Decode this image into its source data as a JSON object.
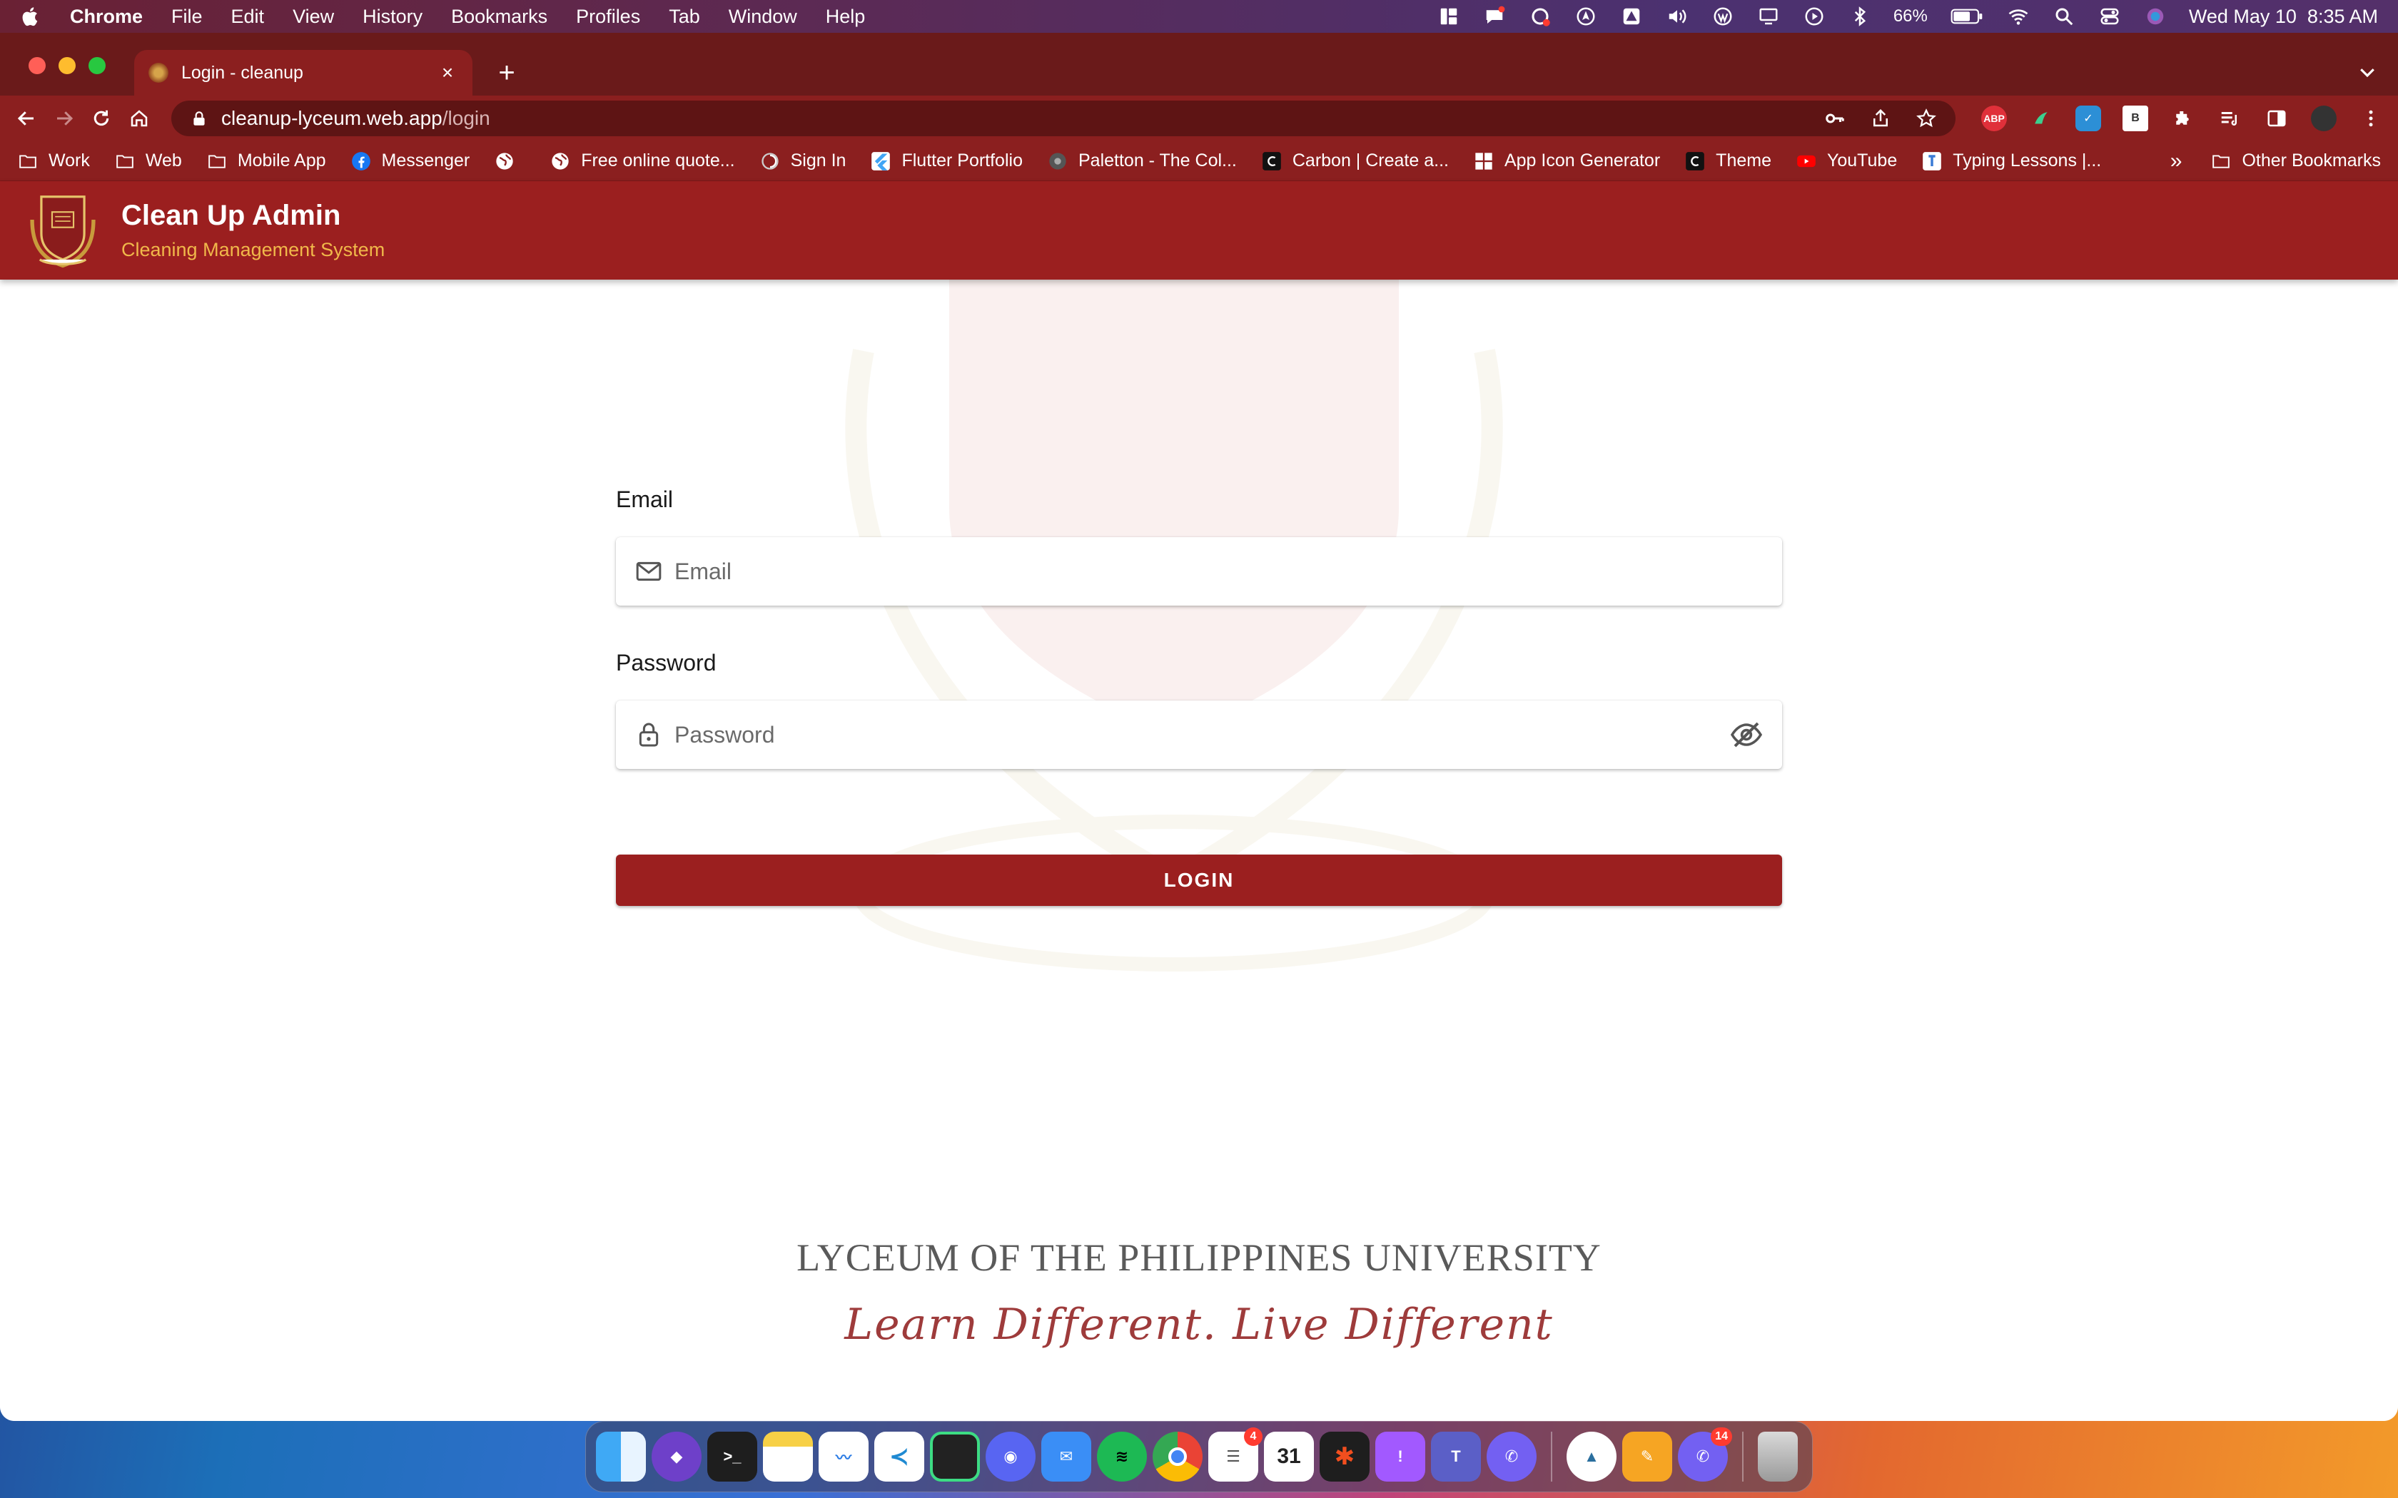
{
  "menubar": {
    "app_name": "Chrome",
    "items": [
      "File",
      "Edit",
      "View",
      "History",
      "Bookmarks",
      "Profiles",
      "Tab",
      "Window",
      "Help"
    ],
    "battery": "66%",
    "datetime": "Wed May 10  8:35 AM"
  },
  "browser": {
    "tab_title": "Login - cleanup",
    "url_host": "cleanup-lyceum.web.app",
    "url_path": "/login",
    "bookmarks": [
      {
        "label": "Work",
        "icon": "folder-icon"
      },
      {
        "label": "Web",
        "icon": "folder-icon"
      },
      {
        "label": "Mobile App",
        "icon": "folder-icon"
      },
      {
        "label": "Messenger",
        "icon": "facebook-icon"
      },
      {
        "label": "",
        "icon": "globe-icon"
      },
      {
        "label": "Free online quote...",
        "icon": "globe-icon"
      },
      {
        "label": "Sign In",
        "icon": "swirl-icon"
      },
      {
        "label": "Flutter Portfolio",
        "icon": "flutter-icon"
      },
      {
        "label": "Paletton - The Col...",
        "icon": "paletton-icon"
      },
      {
        "label": "Carbon | Create a...",
        "icon": "carbon-icon"
      },
      {
        "label": "App Icon Generator",
        "icon": "grid-icon"
      },
      {
        "label": "Theme",
        "icon": "carbon-icon"
      },
      {
        "label": "YouTube",
        "icon": "youtube-icon"
      },
      {
        "label": "Typing Lessons |...",
        "icon": "typing-icon"
      }
    ],
    "overflow_label": "»",
    "other_bookmarks": "Other Bookmarks"
  },
  "app": {
    "title": "Clean Up Admin",
    "subtitle": "Cleaning Management System"
  },
  "form": {
    "email_label": "Email",
    "email_placeholder": "Email",
    "password_label": "Password",
    "password_placeholder": "Password",
    "login_label": "LOGIN"
  },
  "footer": {
    "university": "LYCEUM OF THE PHILIPPINES UNIVERSITY",
    "tagline": "Learn Different. Live Different"
  },
  "dock": {
    "reminders_badge": "4",
    "calendar_day": "31",
    "viber_badge": "14"
  },
  "colors": {
    "brand_maroon": "#9b1f1f",
    "brand_gold": "#f0b84a",
    "tab_dark": "#6a1a1a"
  }
}
